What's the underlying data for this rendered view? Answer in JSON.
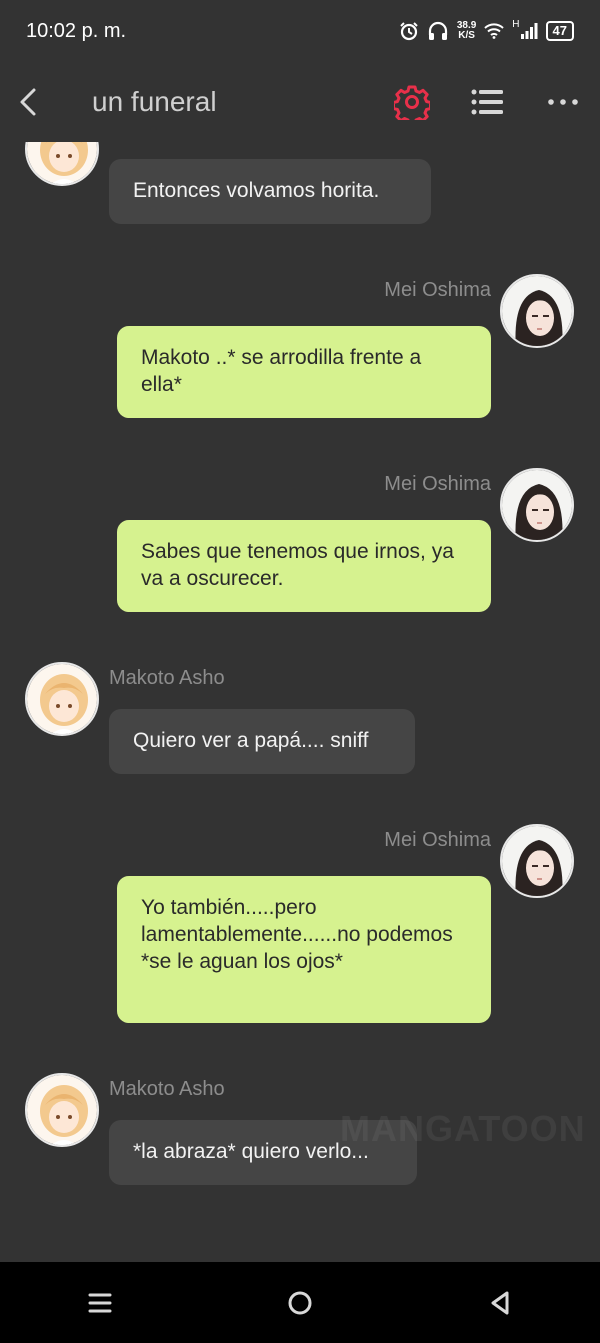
{
  "status_bar": {
    "time": "10:02 p. m.",
    "net_speed_value": "38.9",
    "net_speed_unit": "K/S",
    "signal_label": "H",
    "battery": "47"
  },
  "header": {
    "title": "un funeral"
  },
  "messages": [
    {
      "side": "left",
      "sender": "",
      "text": "Entonces volvamos horita."
    },
    {
      "side": "right",
      "sender": "Mei Oshima",
      "text": "Makoto ..* se arrodilla frente a ella*"
    },
    {
      "side": "right",
      "sender": "Mei Oshima",
      "text": "Sabes que tenemos que irnos, ya va a oscurecer."
    },
    {
      "side": "left",
      "sender": "Makoto Asho",
      "text": "Quiero ver a papá.... sniff"
    },
    {
      "side": "right",
      "sender": "Mei Oshima",
      "text": "Yo también.....pero lamentablemente......no podemos *se le aguan los ojos*"
    },
    {
      "side": "left",
      "sender": "Makoto Asho",
      "text": "*la abraza* quiero verlo..."
    }
  ],
  "watermark": "MANGATOON",
  "colors": {
    "background": "#333333",
    "bubble_left": "#454545",
    "bubble_right": "#d6f28f",
    "accent_gear": "#e8304a"
  },
  "icons": [
    "back-arrow-icon",
    "gear-icon",
    "list-icon",
    "more-icon",
    "menu-icon",
    "home-circle-icon",
    "back-triangle-icon"
  ]
}
